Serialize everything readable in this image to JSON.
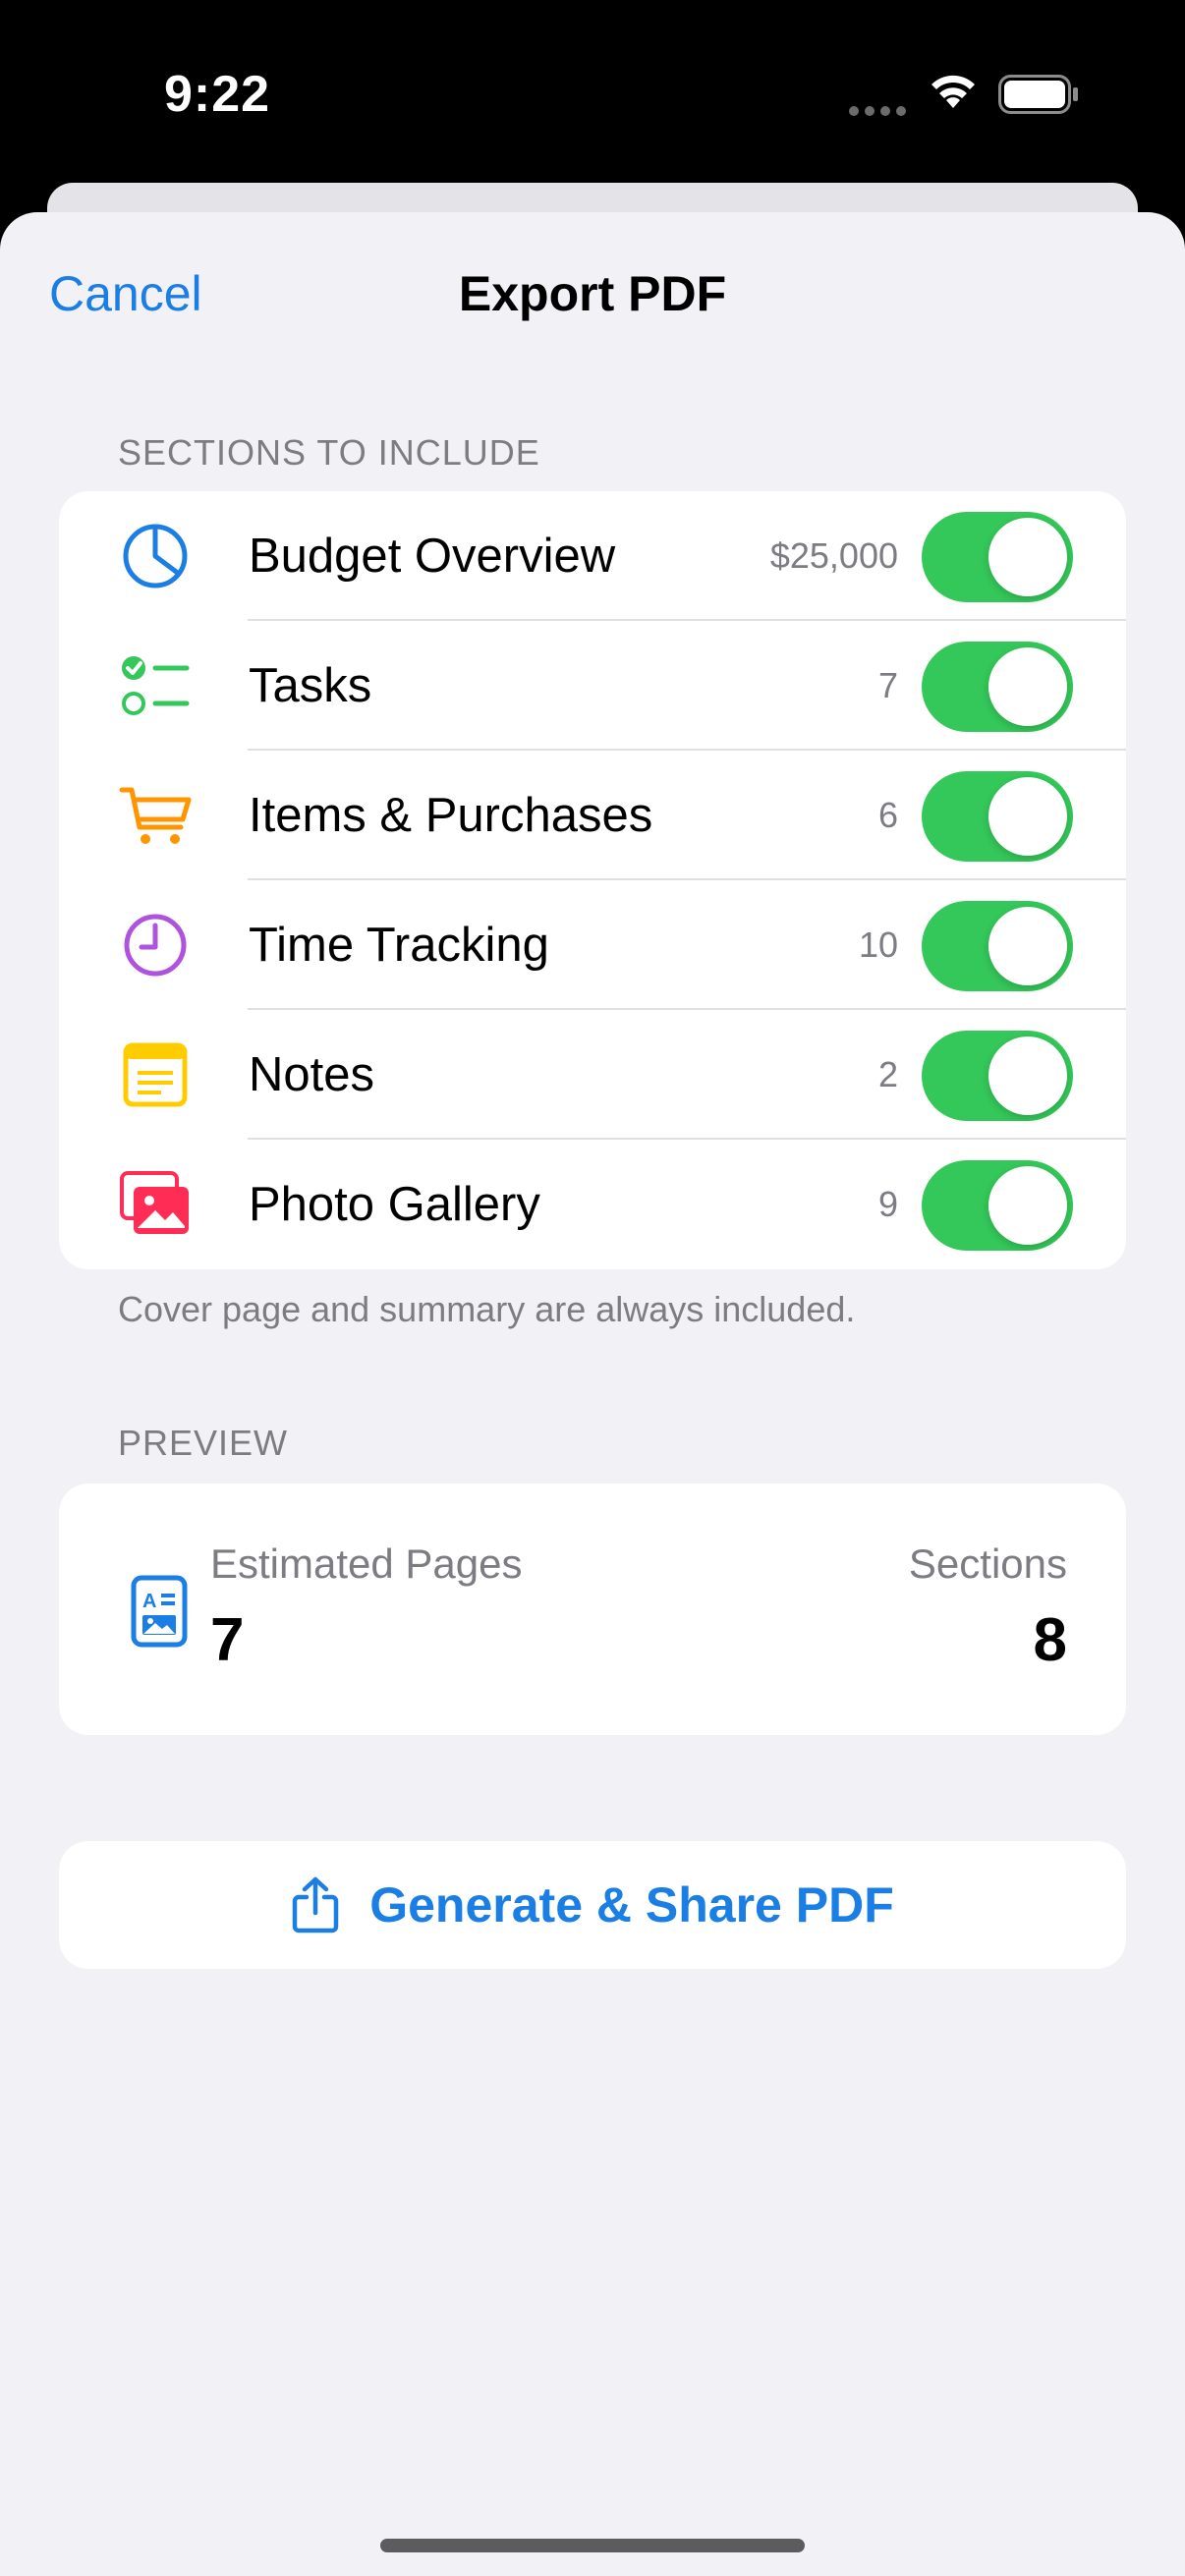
{
  "status_bar": {
    "time": "9:22"
  },
  "nav": {
    "cancel_label": "Cancel",
    "title": "Export PDF"
  },
  "sections_header": "SECTIONS TO INCLUDE",
  "sections": [
    {
      "label": "Budget Overview",
      "count": "$25,000",
      "icon": "pie-chart-icon",
      "enabled": true
    },
    {
      "label": "Tasks",
      "count": "7",
      "icon": "checklist-icon",
      "enabled": true
    },
    {
      "label": "Items & Purchases",
      "count": "6",
      "icon": "cart-icon",
      "enabled": true
    },
    {
      "label": "Time Tracking",
      "count": "10",
      "icon": "clock-icon",
      "enabled": true
    },
    {
      "label": "Notes",
      "count": "2",
      "icon": "notes-icon",
      "enabled": true
    },
    {
      "label": "Photo Gallery",
      "count": "9",
      "icon": "photo-gallery-icon",
      "enabled": true
    }
  ],
  "sections_footer": "Cover page and summary are always included.",
  "preview_header": "PREVIEW",
  "preview": {
    "estimated_pages_label": "Estimated Pages",
    "estimated_pages_value": "7",
    "sections_label": "Sections",
    "sections_value": "8"
  },
  "generate_button_label": "Generate & Share PDF",
  "colors": {
    "accent_blue": "#1a7ee5",
    "toggle_green": "#34c759",
    "tasks_green": "#34c759",
    "cart_orange": "#ff9500",
    "clock_purple": "#af52de",
    "notes_yellow": "#ffcc00",
    "photo_pink": "#ff2d55",
    "background": "#f1f1f6"
  }
}
